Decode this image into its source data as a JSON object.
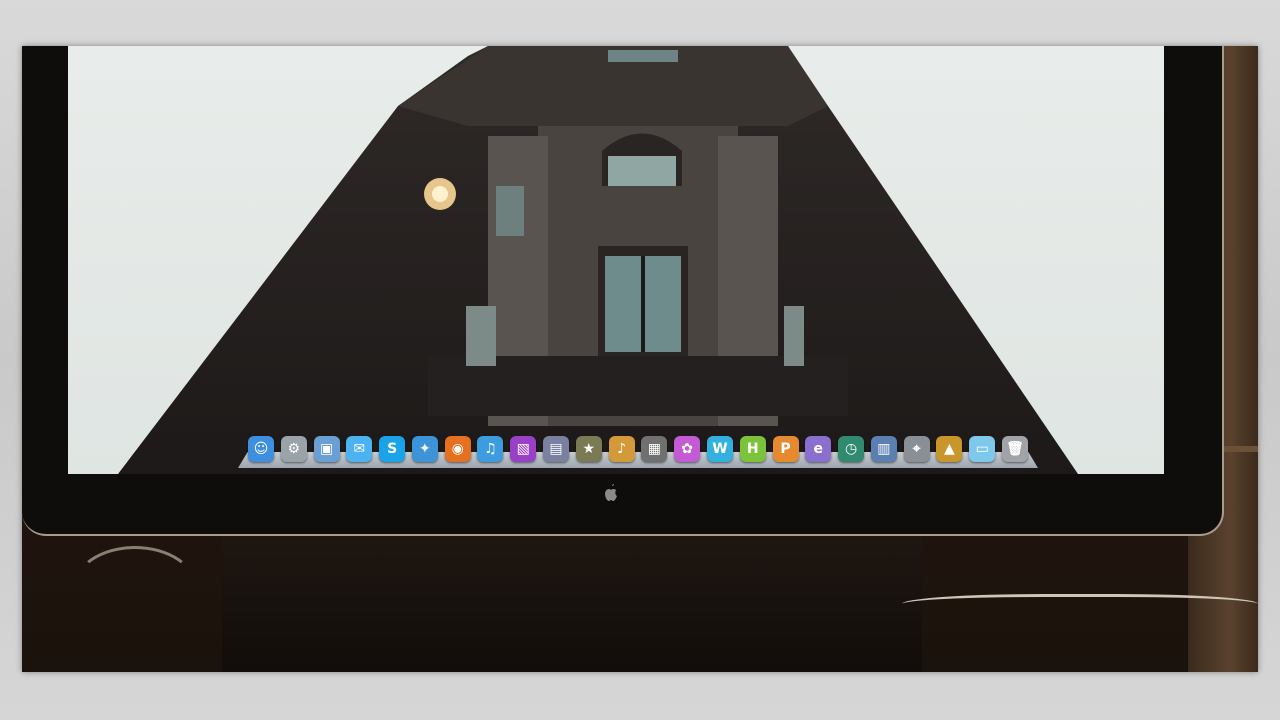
{
  "dock": {
    "items": [
      {
        "name": "finder-icon",
        "glyph": "☺",
        "color": "#3f8fe0"
      },
      {
        "name": "system-preferences-icon",
        "glyph": "⚙",
        "color": "#9aa2aa"
      },
      {
        "name": "preview-icon",
        "glyph": "▣",
        "color": "#6a9fd4"
      },
      {
        "name": "ichat-icon",
        "glyph": "✉",
        "color": "#4cb2f0"
      },
      {
        "name": "skype-icon",
        "glyph": "S",
        "color": "#1aa3e8"
      },
      {
        "name": "safari-icon",
        "glyph": "✦",
        "color": "#3d93d8"
      },
      {
        "name": "firefox-icon",
        "glyph": "◉",
        "color": "#e5701f"
      },
      {
        "name": "itunes-icon",
        "glyph": "♫",
        "color": "#3b9de0"
      },
      {
        "name": "iphoto-icon",
        "glyph": "▧",
        "color": "#9a3fc7"
      },
      {
        "name": "imovie-icon",
        "glyph": "▤",
        "color": "#7a80a0"
      },
      {
        "name": "ilife-star-icon",
        "glyph": "★",
        "color": "#7a7a55"
      },
      {
        "name": "garageband-icon",
        "glyph": "♪",
        "color": "#d49a3a"
      },
      {
        "name": "clapperboard-icon",
        "glyph": "▦",
        "color": "#707070"
      },
      {
        "name": "flower-icon",
        "glyph": "✿",
        "color": "#c35bd4"
      },
      {
        "name": "letter-w-icon",
        "glyph": "W",
        "color": "#32b0e0"
      },
      {
        "name": "letter-h-icon",
        "glyph": "H",
        "color": "#7cc23a"
      },
      {
        "name": "letter-p-icon",
        "glyph": "P",
        "color": "#e58a2e"
      },
      {
        "name": "letter-e-icon",
        "glyph": "e",
        "color": "#8a6fd0"
      },
      {
        "name": "time-machine-icon",
        "glyph": "◷",
        "color": "#2f8a6f"
      },
      {
        "name": "dashboard-icon",
        "glyph": "▥",
        "color": "#5a7fb0"
      },
      {
        "name": "scanner-icon",
        "glyph": "⌖",
        "color": "#8a8f96"
      },
      {
        "name": "pyramid-app-icon",
        "glyph": "▲",
        "color": "#c8962a"
      },
      {
        "name": "downloads-folder-icon",
        "glyph": "▭",
        "color": "#7ec8ec"
      },
      {
        "name": "trash-icon",
        "glyph": "🗑",
        "color": "#a0a4a8"
      }
    ]
  },
  "monitor": {
    "logo_icon": "apple-logo-icon",
    "logo_glyph": ""
  }
}
